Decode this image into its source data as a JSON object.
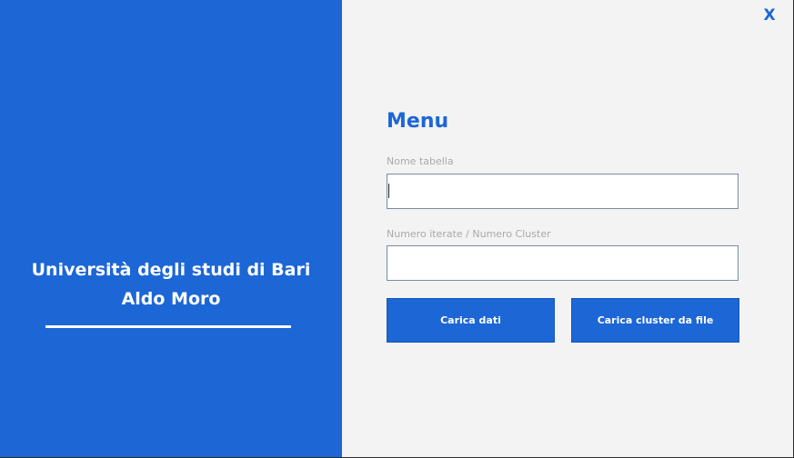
{
  "brand": {
    "line1": "Università degli studi di Bari",
    "line2": "Aldo Moro"
  },
  "window": {
    "close_label": "X"
  },
  "menu": {
    "title": "Menu",
    "fields": [
      {
        "label": "Nome tabella",
        "value": ""
      },
      {
        "label": "Numero iterate / Numero Cluster",
        "value": ""
      }
    ],
    "buttons": {
      "load_data": "Carica dati",
      "load_clusters_file": "Carica cluster da file"
    }
  },
  "colors": {
    "accent": "#1c66d6",
    "panel_background": "#f3f3f3",
    "label_gray": "#a9a9a9",
    "white": "#ffffff"
  }
}
